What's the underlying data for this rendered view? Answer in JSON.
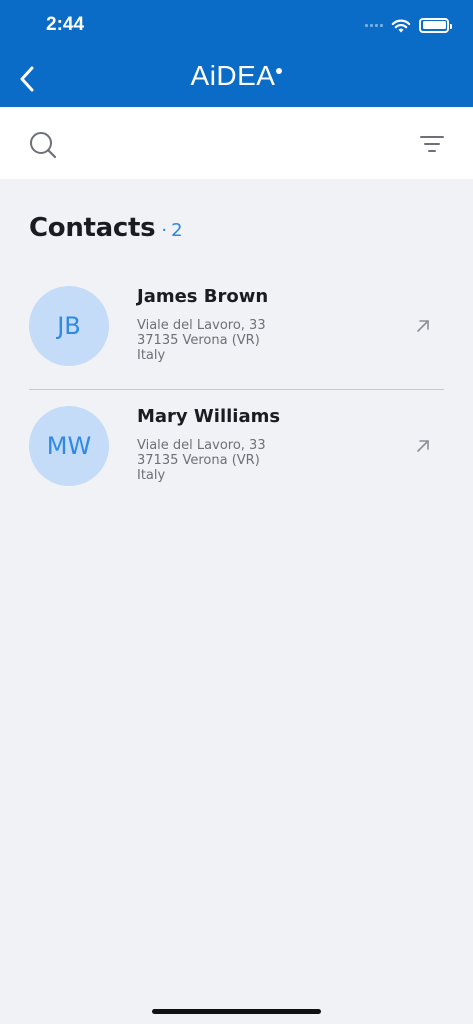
{
  "status_bar": {
    "time": "2:44"
  },
  "header": {
    "title": "AiDEA",
    "back_icon": "chevron-left-icon",
    "color": "#0a6cc6"
  },
  "toolbar": {
    "search_icon": "search-icon",
    "filter_icon": "filter-icon"
  },
  "contacts": {
    "title": "Contacts",
    "separator": "·",
    "count": "2",
    "items": [
      {
        "initials": "JB",
        "name": "James Brown",
        "address_line1": "Viale del Lavoro, 33",
        "address_line2": "37135 Verona (VR)",
        "address_line3": "Italy",
        "action_icon": "arrow-up-right-icon"
      },
      {
        "initials": "MW",
        "name": "Mary Williams",
        "address_line1": "Viale del Lavoro, 33",
        "address_line2": "37135 Verona (VR)",
        "address_line3": "Italy",
        "action_icon": "arrow-up-right-icon"
      }
    ]
  }
}
